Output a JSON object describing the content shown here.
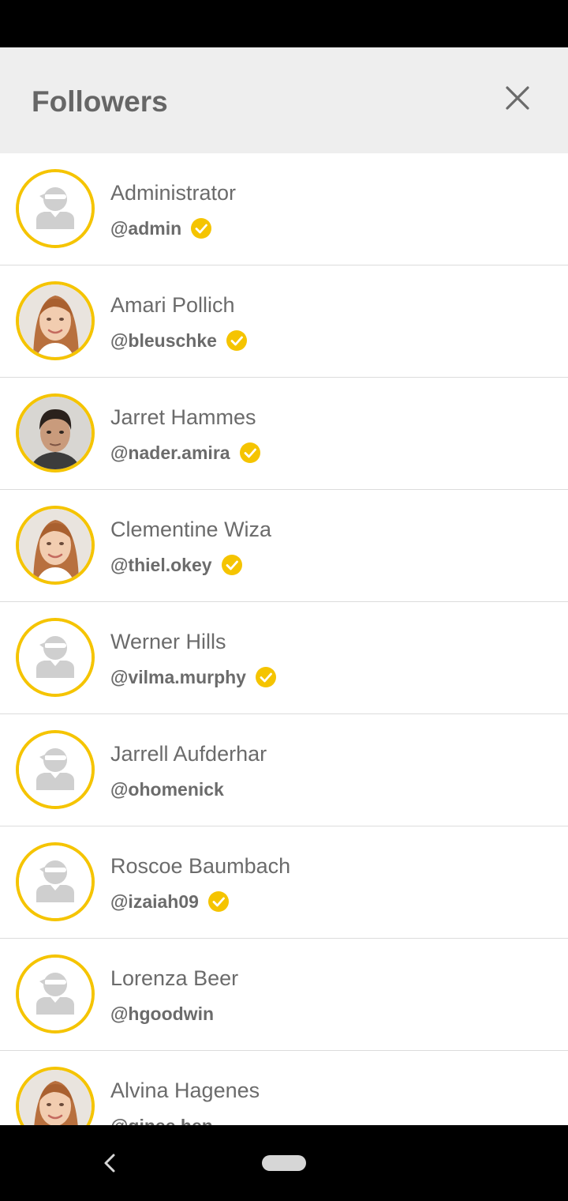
{
  "header": {
    "title": "Followers",
    "close_icon": "close-icon"
  },
  "colors": {
    "accent": "#f5c400",
    "header_bg": "#eeeeee",
    "text": "#6b6b6b"
  },
  "followers": [
    {
      "name": "Administrator",
      "handle": "@admin",
      "verified": true,
      "avatar": "placeholder"
    },
    {
      "name": "Amari Pollich",
      "handle": "@bleuschke",
      "verified": true,
      "avatar": "woman-photo"
    },
    {
      "name": "Jarret Hammes",
      "handle": "@nader.amira",
      "verified": true,
      "avatar": "man-photo"
    },
    {
      "name": "Clementine Wiza",
      "handle": "@thiel.okey",
      "verified": true,
      "avatar": "woman-photo"
    },
    {
      "name": "Werner Hills",
      "handle": "@vilma.murphy",
      "verified": true,
      "avatar": "placeholder"
    },
    {
      "name": "Jarrell Aufderhar",
      "handle": "@ohomenick",
      "verified": false,
      "avatar": "placeholder"
    },
    {
      "name": "Roscoe Baumbach",
      "handle": "@izaiah09",
      "verified": true,
      "avatar": "placeholder"
    },
    {
      "name": "Lorenza Beer",
      "handle": "@hgoodwin",
      "verified": false,
      "avatar": "placeholder"
    },
    {
      "name": "Alvina Hagenes",
      "handle": "@ginee.hen",
      "verified": false,
      "avatar": "woman-photo"
    }
  ],
  "nav": {
    "back_icon": "back-icon",
    "home_icon": "home-pill-icon"
  }
}
